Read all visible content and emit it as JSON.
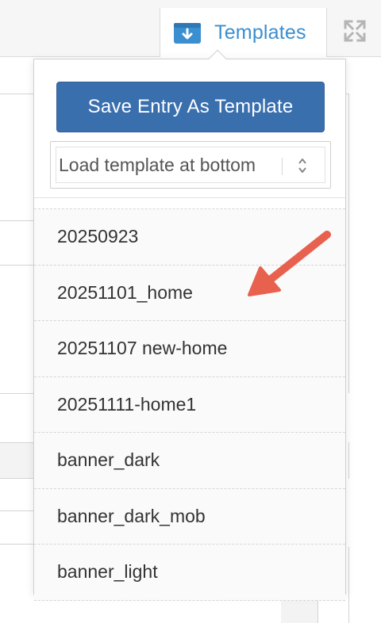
{
  "toolbar": {
    "templates_label": "Templates",
    "templates_icon": "template-box-icon",
    "fullscreen_icon": "fullscreen-icon"
  },
  "popover": {
    "save_label": "Save Entry As Template",
    "load_select": {
      "value": "Load template at bottom"
    },
    "templates": [
      "20250923",
      "20251101_home",
      "20251107 new-home",
      "20251111-home1",
      "banner_dark",
      "banner_dark_mob",
      "banner_light"
    ]
  },
  "colors": {
    "accent": "#3a8fd0",
    "button": "#3a6fae",
    "annotation_arrow": "#e8614e"
  }
}
